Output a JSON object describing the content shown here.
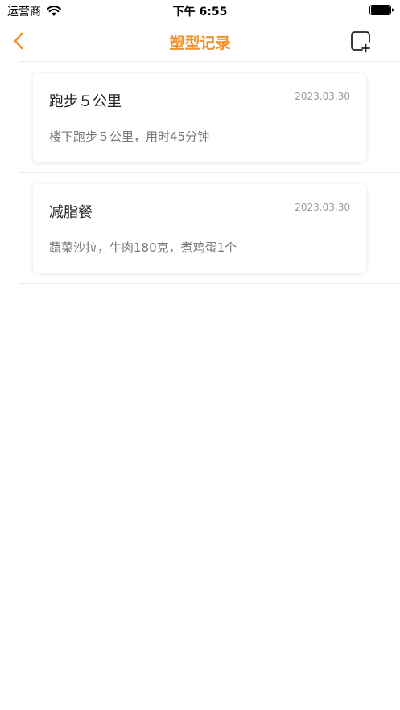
{
  "status_bar": {
    "carrier": "运营商",
    "time": "下午 6:55"
  },
  "nav": {
    "title": "塑型记录",
    "back_icon": "chevron-left-icon",
    "add_icon": "square-plus-icon",
    "accent_color": "#f5922d"
  },
  "records": [
    {
      "title": "跑步５公里",
      "date": "2023.03.30",
      "description": "楼下跑步５公里，用时45分钟"
    },
    {
      "title": "减脂餐",
      "date": "2023.03.30",
      "description": "蔬菜沙拉，牛肉180克，煮鸡蛋1个"
    }
  ]
}
